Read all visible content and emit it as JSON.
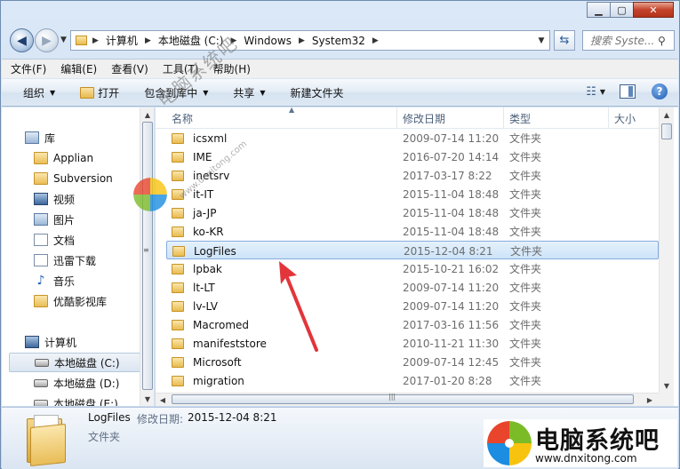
{
  "window": {
    "caption_buttons": [
      "minimize",
      "maximize",
      "close"
    ]
  },
  "nav": {
    "breadcrumb": [
      "计算机",
      "本地磁盘 (C:)",
      "Windows",
      "System32"
    ],
    "search_placeholder": "搜索 Syste..."
  },
  "menubar": [
    "文件(F)",
    "编辑(E)",
    "查看(V)",
    "工具(T)",
    "帮助(H)"
  ],
  "commandbar": {
    "organize": "组织",
    "open": "打开",
    "include_in_library": "包含到库中",
    "share": "共享",
    "new_folder": "新建文件夹"
  },
  "sidebar": {
    "items": [
      {
        "label": "库",
        "icon": "library-icon"
      },
      {
        "label": "Applian",
        "icon": "folder-icon"
      },
      {
        "label": "Subversion",
        "icon": "folder-icon"
      },
      {
        "label": "视频",
        "icon": "video-icon"
      },
      {
        "label": "图片",
        "icon": "picture-icon"
      },
      {
        "label": "文档",
        "icon": "document-icon"
      },
      {
        "label": "迅雷下载",
        "icon": "document-icon"
      },
      {
        "label": "音乐",
        "icon": "music-icon"
      },
      {
        "label": "优酷影视库",
        "icon": "folder-icon"
      },
      {
        "label": "计算机",
        "icon": "computer-icon"
      },
      {
        "label": "本地磁盘 (C:)",
        "icon": "drive-icon"
      },
      {
        "label": "本地磁盘 (D:)",
        "icon": "drive-icon"
      },
      {
        "label": "本地磁盘 (E:)",
        "icon": "drive-icon"
      }
    ]
  },
  "columns": {
    "name": "名称",
    "date": "修改日期",
    "type": "类型",
    "size": "大小"
  },
  "files": [
    {
      "name": "icsxml",
      "date": "2009-07-14 11:20",
      "type": "文件夹"
    },
    {
      "name": "IME",
      "date": "2016-07-20 14:14",
      "type": "文件夹"
    },
    {
      "name": "inetsrv",
      "date": "2017-03-17 8:22",
      "type": "文件夹"
    },
    {
      "name": "it-IT",
      "date": "2015-11-04 18:48",
      "type": "文件夹"
    },
    {
      "name": "ja-JP",
      "date": "2015-11-04 18:48",
      "type": "文件夹"
    },
    {
      "name": "ko-KR",
      "date": "2015-11-04 18:48",
      "type": "文件夹"
    },
    {
      "name": "LogFiles",
      "date": "2015-12-04 8:21",
      "type": "文件夹"
    },
    {
      "name": "lpbak",
      "date": "2015-10-21 16:02",
      "type": "文件夹"
    },
    {
      "name": "lt-LT",
      "date": "2009-07-14 11:20",
      "type": "文件夹"
    },
    {
      "name": "lv-LV",
      "date": "2009-07-14 11:20",
      "type": "文件夹"
    },
    {
      "name": "Macromed",
      "date": "2017-03-16 11:56",
      "type": "文件夹"
    },
    {
      "name": "manifeststore",
      "date": "2010-11-21 11:30",
      "type": "文件夹"
    },
    {
      "name": "Microsoft",
      "date": "2009-07-14 12:45",
      "type": "文件夹"
    },
    {
      "name": "migration",
      "date": "2017-01-20 8:28",
      "type": "文件夹"
    }
  ],
  "details": {
    "name": "LogFiles",
    "modified_label": "修改日期:",
    "modified_value": "2015-12-04 8:21",
    "type": "文件夹"
  },
  "watermark": {
    "diagonal_text": "电脑系统吧",
    "diagonal_url": "www.dnxitong.com",
    "brand_title": "电脑系统吧",
    "brand_url": "www.dnxitong.com"
  },
  "colors": {
    "selection": "#cde3f8",
    "annotation_arrow": "#e2353a",
    "logo_red": "#e8452c",
    "logo_green": "#7cbb28",
    "logo_blue": "#1c8de0",
    "logo_yellow": "#f7c30f"
  }
}
